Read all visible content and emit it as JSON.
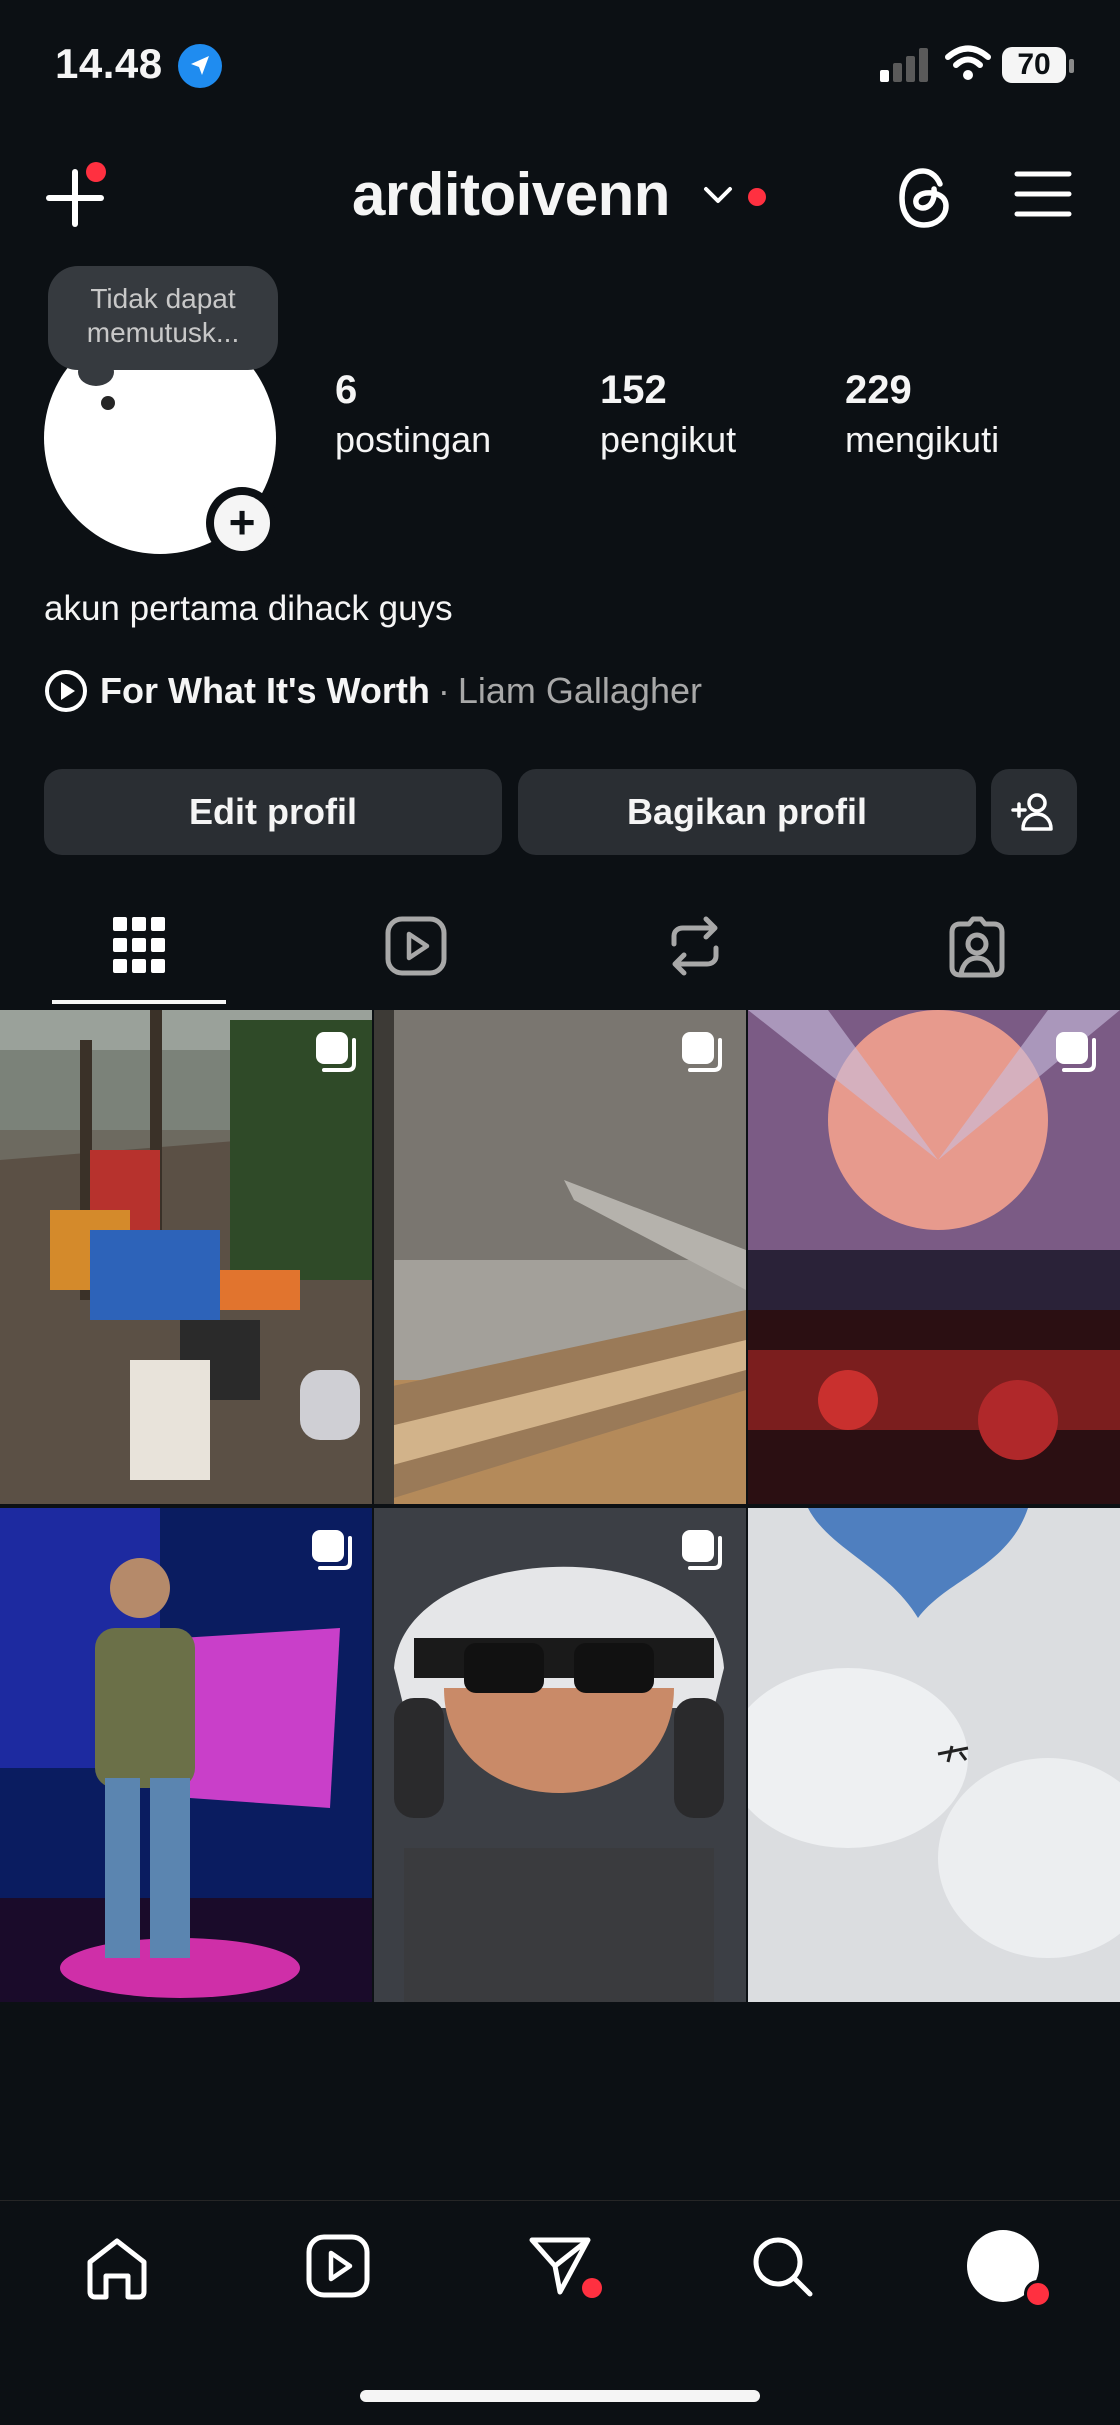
{
  "status_bar": {
    "time": "14.48",
    "battery": "70"
  },
  "header": {
    "username": "arditoivenn"
  },
  "note": {
    "text": "Tidak dapat memutusk..."
  },
  "stats": [
    {
      "value": "6",
      "label": "postingan"
    },
    {
      "value": "152",
      "label": "pengikut"
    },
    {
      "value": "229",
      "label": "mengikuti"
    }
  ],
  "bio": "akun pertama dihack guys",
  "music": {
    "title": "For What It's Worth",
    "separator": "·",
    "artist": "Liam Gallagher"
  },
  "buttons": {
    "edit": "Edit profil",
    "share": "Bagikan profil"
  },
  "tabs": [
    "grid-icon",
    "reels-icon",
    "reposts-icon",
    "tagged-icon"
  ],
  "posts": [
    {
      "subject": "dock with coolers",
      "multi": true
    },
    {
      "subject": "airplane wing view",
      "multi": true
    },
    {
      "subject": "concert stage",
      "multi": true
    },
    {
      "subject": "singer on stage",
      "multi": true
    },
    {
      "subject": "helmet selfie",
      "multi": true
    },
    {
      "subject": "sky with airplane",
      "multi": false
    }
  ],
  "colors": {
    "background": "#0c1014",
    "notification": "#ff3040",
    "location": "#1f8cf0",
    "button": "#2a2e33"
  }
}
